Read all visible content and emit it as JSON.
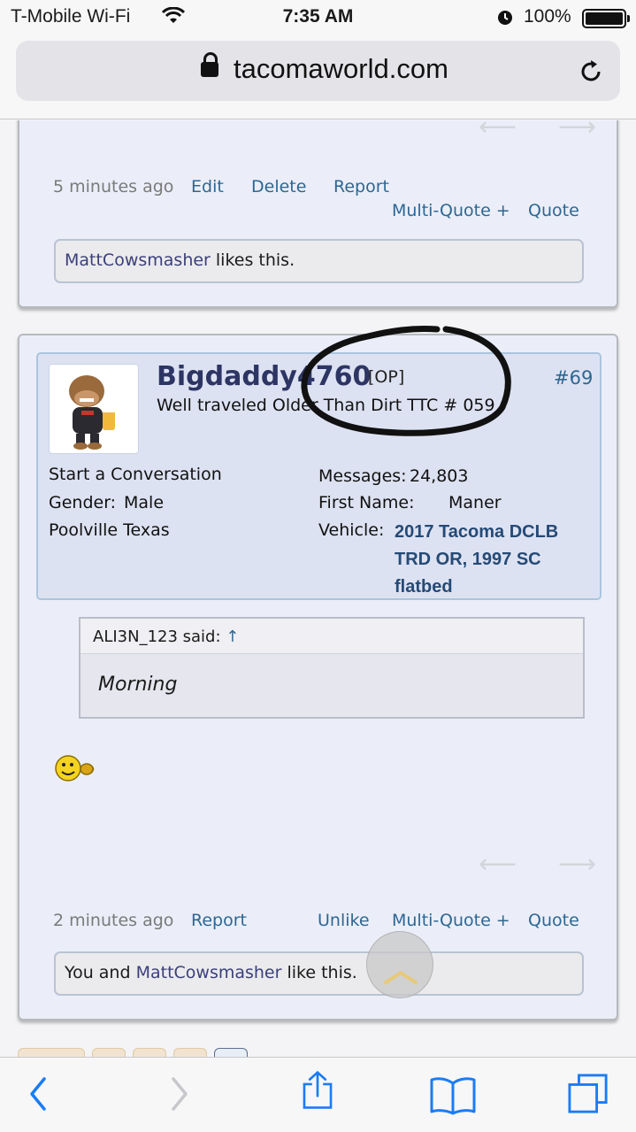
{
  "status_bar": {
    "carrier": "T-Mobile Wi-Fi",
    "time": "7:35 AM",
    "battery": "100%"
  },
  "browser": {
    "host": "tacomaworld.com"
  },
  "post_prev": {
    "time": "5 minutes ago",
    "actions": [
      "Edit",
      "Delete",
      "Report"
    ],
    "multiquote": "Multi-Quote +",
    "quote": "Quote",
    "likes_user": "MattCowsmasher",
    "likes_text": " likes this."
  },
  "post": {
    "username": "Bigdaddy4760",
    "op_badge": "[OP]",
    "post_number": "#69",
    "user_title": "Well traveled Older Than Dirt TTC # 059",
    "start_conversation": "Start a Conversation",
    "gender_label": "Gender:",
    "gender": "Male",
    "location": "Poolville Texas",
    "messages_label": "Messages:",
    "messages": "24,803",
    "first_name_label": "First Name:",
    "first_name": "Maner",
    "vehicle_label": "Vehicle:",
    "vehicle_lines": [
      "2017 Tacoma DCLB",
      "TRD OR, 1997 SC",
      "flatbed"
    ],
    "quote_author": "ALI3N_123 said:",
    "quote_arrow": "↑",
    "quote_body": "Morning",
    "time": "2 minutes ago",
    "report": "Report",
    "unlike": "Unlike",
    "multiquote": "Multi-Quote +",
    "quote": "Quote",
    "likes_prefix": "You and ",
    "likes_user": "MattCowsmasher",
    "likes_suffix": " like this."
  },
  "icons": {
    "wifi": "wifi-icon",
    "alarm": "alarm-icon",
    "lock": "lock-icon",
    "reload": "reload-icon",
    "back": "back-icon",
    "forward": "forward-icon",
    "share": "share-icon",
    "bookmarks": "bookmarks-icon",
    "tabs": "tabs-icon"
  },
  "colors": {
    "link": "#2d6793",
    "username": "#2c3563",
    "ios_blue": "#1a7cf5"
  }
}
